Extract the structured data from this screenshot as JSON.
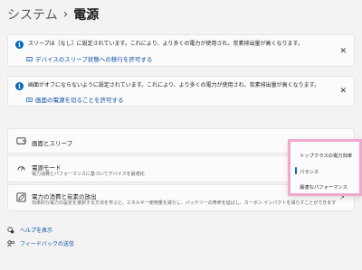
{
  "breadcrumb": {
    "parent": "システム",
    "separator": "›",
    "current": "電源"
  },
  "notices": [
    {
      "message": "スリープは［なし］に設定されています。これにより、より多くの電力が使用され、炭素排出量が高くなります。",
      "link": "デバイスのスリープ状態への移行を許可する"
    },
    {
      "message": "画面がオフにならないように設定されています。これにより、より多くの電力が使用され、炭素排出量が高くなります。",
      "link": "画面の電源を切ることを許可する"
    }
  ],
  "cards": {
    "screen_sleep": {
      "title": "画面とスリープ"
    },
    "power_mode": {
      "title": "電源モード",
      "desc": "電力消費とパフォーマンスに基づいてデバイスを最適化"
    },
    "energy": {
      "title": "電力の消費と炭素の放出",
      "desc": "効率的な電力の設定を選択する方法を学ぶと、エネルギー使用量を減らし、バッテリーの寿命を延ばし、カーボン インパクトを減らすことができます"
    }
  },
  "power_mode_dropdown": {
    "options": [
      "トップクラスの電力効率",
      "バランス",
      "最適なパフォーマンス"
    ],
    "selected_index": 1
  },
  "help": {
    "get_help": "ヘルプを表示",
    "feedback": "フィードバックの送信"
  },
  "colors": {
    "accent": "#0067c0",
    "highlight_border": "#f0a8cf",
    "background": "#f3f3f3"
  }
}
